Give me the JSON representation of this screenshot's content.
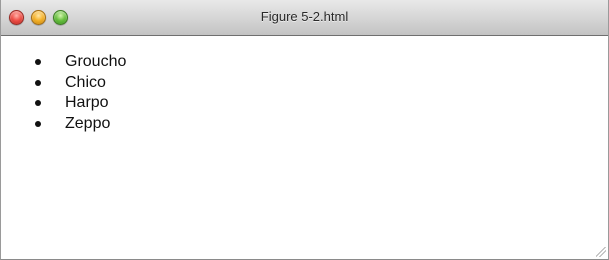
{
  "window": {
    "title": "Figure 5-2.html",
    "controls": {
      "close": "close-button",
      "minimize": "minimize-button",
      "zoom": "zoom-button"
    }
  },
  "list": {
    "items": [
      "Groucho",
      "Chico",
      "Harpo",
      "Zeppo"
    ]
  },
  "colors": {
    "close": "#f0524a",
    "minimize": "#f5b32d",
    "zoom": "#6cc243",
    "titlebar": "#d6d6d6",
    "text": "#111111"
  }
}
